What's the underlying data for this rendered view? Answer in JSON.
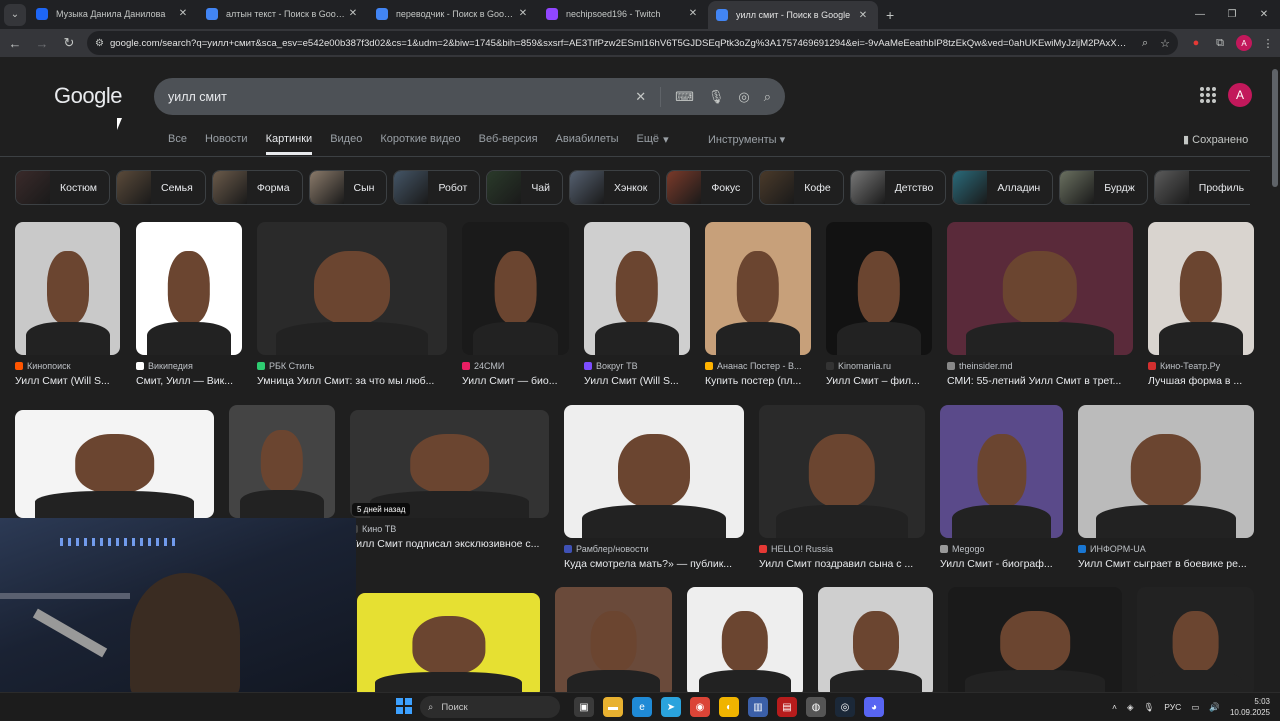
{
  "browser": {
    "tabs": [
      {
        "title": "Музыка Данила Данилова",
        "icon_color": "#1e66f5",
        "active": false
      },
      {
        "title": "алтын текст - Поиск в Google",
        "icon_color": "#4285f4",
        "active": false
      },
      {
        "title": "переводчик - Поиск в Google",
        "icon_color": "#4285f4",
        "active": false
      },
      {
        "title": "nechipsoed196 - Twitch",
        "icon_color": "#9146ff",
        "active": false
      },
      {
        "title": "уилл смит - Поиск в Google",
        "icon_color": "#4285f4",
        "active": true
      }
    ],
    "url": "google.com/search?q=уилл+смит&sca_esv=e542e00b387f3d02&cs=1&udm=2&biw=1745&bih=859&sxsrf=AE3TifPzw2ESml16hV6T5GJDSEqPtk3oZg%3A1757469691294&ei=-9vAaMeEeathbIP8tzEkQw&ved=0ahUKEwiMyJzljM2PAxXmVkEA...",
    "profile_initial": "A"
  },
  "google": {
    "logo": "Google",
    "query": "уилл смит",
    "tabs": [
      "Все",
      "Новости",
      "Картинки",
      "Видео",
      "Короткие видео",
      "Веб-версия",
      "Авиабилеты",
      "Ещё"
    ],
    "active_tab": "Картинки",
    "tools": "Инструменты",
    "saved": "Сохранено",
    "avatar_initial": "A"
  },
  "chips": [
    {
      "label": "Костюм",
      "color": "#3a2a2a"
    },
    {
      "label": "Семья",
      "color": "#5a4a3a"
    },
    {
      "label": "Форма",
      "color": "#6a5a4a"
    },
    {
      "label": "Сын",
      "color": "#8a7a6a"
    },
    {
      "label": "Робот",
      "color": "#445566"
    },
    {
      "label": "Чай",
      "color": "#2a3a2a"
    },
    {
      "label": "Хэнкок",
      "color": "#556070"
    },
    {
      "label": "Фокус",
      "color": "#7a3a2a"
    },
    {
      "label": "Кофе",
      "color": "#4a3a2a"
    },
    {
      "label": "Детство",
      "color": "#777777"
    },
    {
      "label": "Алладин",
      "color": "#2a6a7a"
    },
    {
      "label": "Бурдж",
      "color": "#6a7060"
    },
    {
      "label": "Профиль",
      "color": "#5a5a5a"
    }
  ],
  "results": [
    {
      "source": "Кинопоиск",
      "caption": "Уилл Смит (Will S...",
      "src_color": "#ff5500",
      "bg": "#c9c9c9"
    },
    {
      "source": "Википедия",
      "caption": "Смит, Уилл — Вик...",
      "src_color": "#ffffff",
      "bg": "#ffffff"
    },
    {
      "source": "РБК Стиль",
      "caption": "Умница Уилл Смит: за что мы люб...",
      "src_color": "#2ecc71",
      "bg": "#2a2a2a"
    },
    {
      "source": "24СМИ",
      "caption": "Уилл Смит — био...",
      "src_color": "#e91e63",
      "bg": "#1a1a1a"
    },
    {
      "source": "Вокруг ТВ",
      "caption": "Уилл Смит (Will S...",
      "src_color": "#7c4dff",
      "bg": "#cfcfcf"
    },
    {
      "source": "Ананас Постер - В...",
      "caption": "Купить постер (пл...",
      "src_color": "#ffb300",
      "bg": "#c7a07a"
    },
    {
      "source": "Kinomania.ru",
      "caption": "Уилл Смит – фил...",
      "src_color": "#333333",
      "bg": "#121212"
    },
    {
      "source": "theinsider.md",
      "caption": "СМИ: 55-летний Уилл Смит в трет...",
      "src_color": "#888888",
      "bg": "#5a2a3a"
    },
    {
      "source": "Кино-Театр.Ру",
      "caption": "Лучшая форма в ...",
      "src_color": "#d32f2f",
      "bg": "#d9d4cf"
    },
    {
      "source": "",
      "caption": "",
      "src_color": "#888888",
      "bg": "#f4f4f4"
    },
    {
      "source": "",
      "caption": "",
      "src_color": "#888888",
      "bg": "#444444"
    },
    {
      "source": "Кино ТВ",
      "caption": "Уилл Смит подписал эксклюзивное с...",
      "src_color": "#444444",
      "bg": "#333333",
      "badge": "5 дней назад"
    },
    {
      "source": "Рамблер/новости",
      "caption": "Куда смотрела мать?» — публик...",
      "src_color": "#3f51b5",
      "bg": "#eeeeee"
    },
    {
      "source": "HELLO! Russia",
      "caption": "Уилл Смит поздравил сына с ...",
      "src_color": "#e53935",
      "bg": "#2a2a2a"
    },
    {
      "source": "Megogo",
      "caption": "Уилл Смит - биограф...",
      "src_color": "#999999",
      "bg": "#5a4a8a"
    },
    {
      "source": "ИНФОРМ-UA",
      "caption": "Уилл Смит сыграет в боевике ре...",
      "src_color": "#1976d2",
      "bg": "#bbbbbb"
    },
    {
      "source": "",
      "caption": "",
      "src_color": "#888888",
      "bg": "#e6e032"
    },
    {
      "source": "",
      "caption": "",
      "src_color": "#888888",
      "bg": "#6a4a3a"
    },
    {
      "source": "",
      "caption": "",
      "src_color": "#888888",
      "bg": "#eeeeee"
    },
    {
      "source": "",
      "caption": "",
      "src_color": "#888888",
      "bg": "#cfcfcf"
    },
    {
      "source": "",
      "caption": "",
      "src_color": "#888888",
      "bg": "#1a1a1a"
    },
    {
      "source": "",
      "caption": "",
      "src_color": "#888888",
      "bg": "#222222"
    }
  ],
  "taskbar": {
    "search_placeholder": "Поиск",
    "language": "РУС",
    "time": "5:03",
    "date": "10.09.2025"
  }
}
